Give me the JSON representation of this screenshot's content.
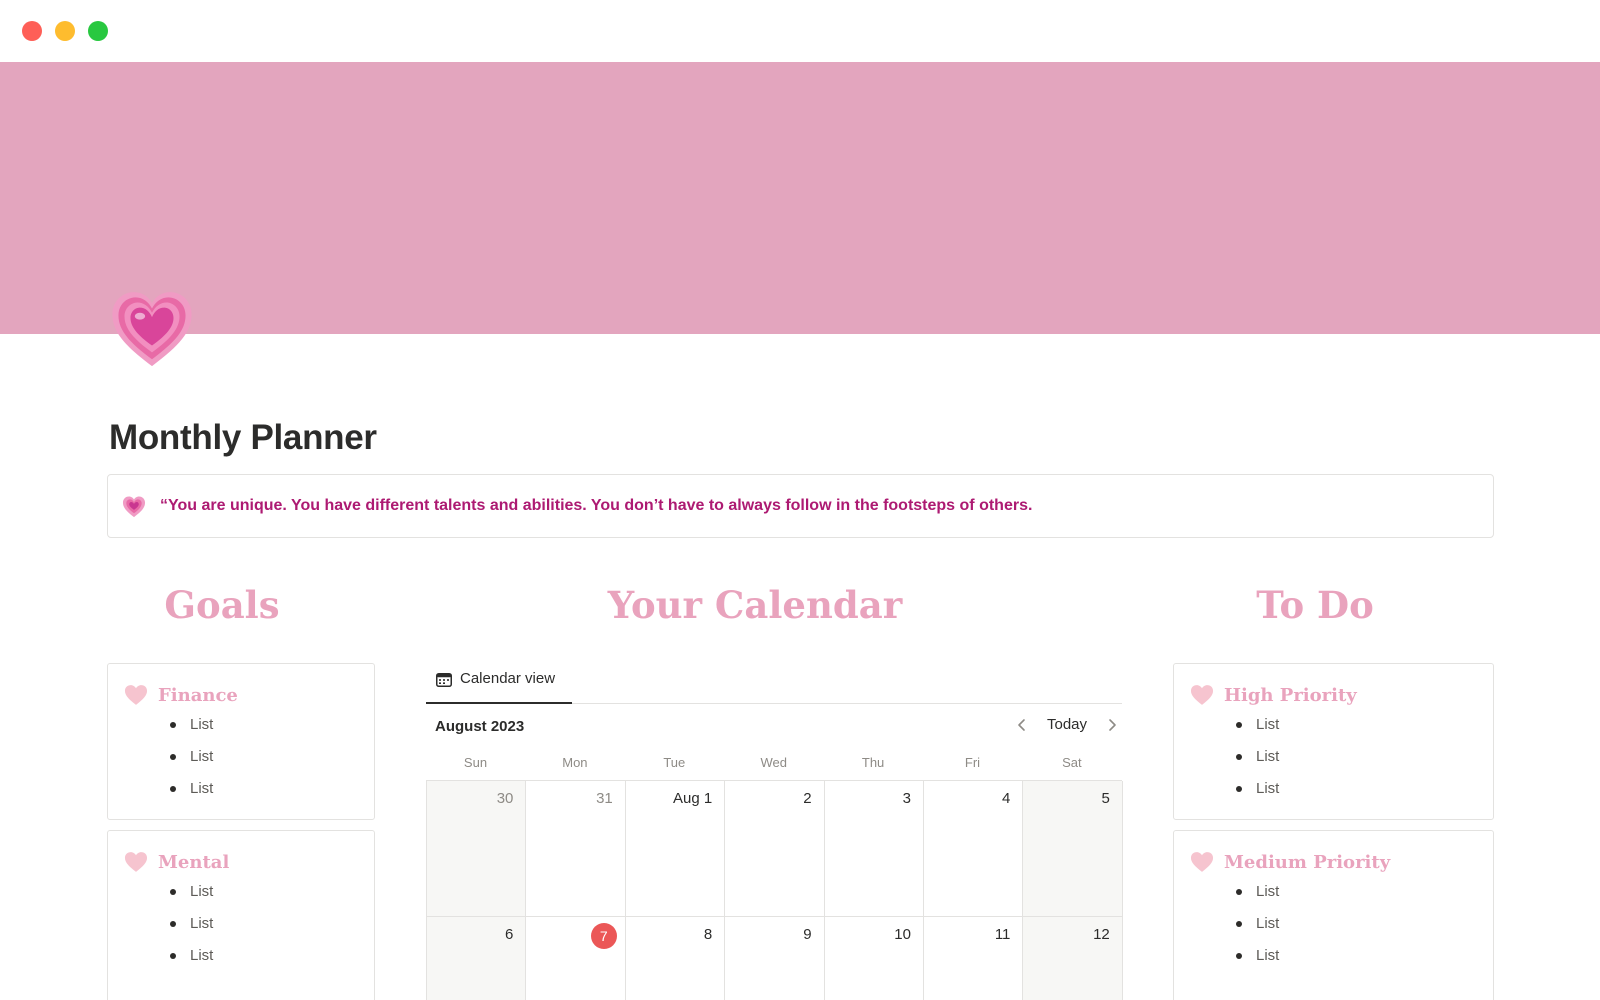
{
  "window": {
    "controls": [
      "close-button",
      "minimize-button",
      "zoom-button"
    ]
  },
  "cover": {
    "color": "#e3a5be"
  },
  "page": {
    "title": "Monthly Planner",
    "icon": "heart-icon"
  },
  "callout": {
    "icon": "heart-icon",
    "text": "“You are unique. You have different talents and abilities. You don’t have to always follow in the footsteps of others."
  },
  "headings": {
    "goals": "Goals",
    "calendar": "Your Calendar",
    "todo": "To Do"
  },
  "goals": [
    {
      "title": "Finance",
      "items": [
        "List",
        "List",
        "List"
      ]
    },
    {
      "title": "Mental",
      "items": [
        "List",
        "List",
        "List"
      ]
    }
  ],
  "todo": [
    {
      "title": "High Priority",
      "items": [
        "List",
        "List",
        "List"
      ]
    },
    {
      "title": "Medium Priority",
      "items": [
        "List",
        "List",
        "List"
      ]
    }
  ],
  "calendar": {
    "tab_label": "Calendar view",
    "month_label": "August 2023",
    "today_label": "Today",
    "weekdays": [
      "Sun",
      "Mon",
      "Tue",
      "Wed",
      "Thu",
      "Fri",
      "Sat"
    ],
    "weeks": [
      [
        {
          "label": "30",
          "muted": true
        },
        {
          "label": "31",
          "muted": true
        },
        {
          "label": "Aug 1",
          "muted": false
        },
        {
          "label": "2",
          "muted": false
        },
        {
          "label": "3",
          "muted": false
        },
        {
          "label": "4",
          "muted": false
        },
        {
          "label": "5",
          "muted": false
        }
      ],
      [
        {
          "label": "6",
          "muted": false
        },
        {
          "label": "7",
          "muted": false,
          "today": true
        },
        {
          "label": "8",
          "muted": false
        },
        {
          "label": "9",
          "muted": false
        },
        {
          "label": "10",
          "muted": false
        },
        {
          "label": "11",
          "muted": false
        },
        {
          "label": "12",
          "muted": false
        }
      ]
    ]
  },
  "colors": {
    "accent_pink": "#e9a3bd",
    "quote_text": "#ad1a72",
    "today_marker": "#eb5757"
  }
}
